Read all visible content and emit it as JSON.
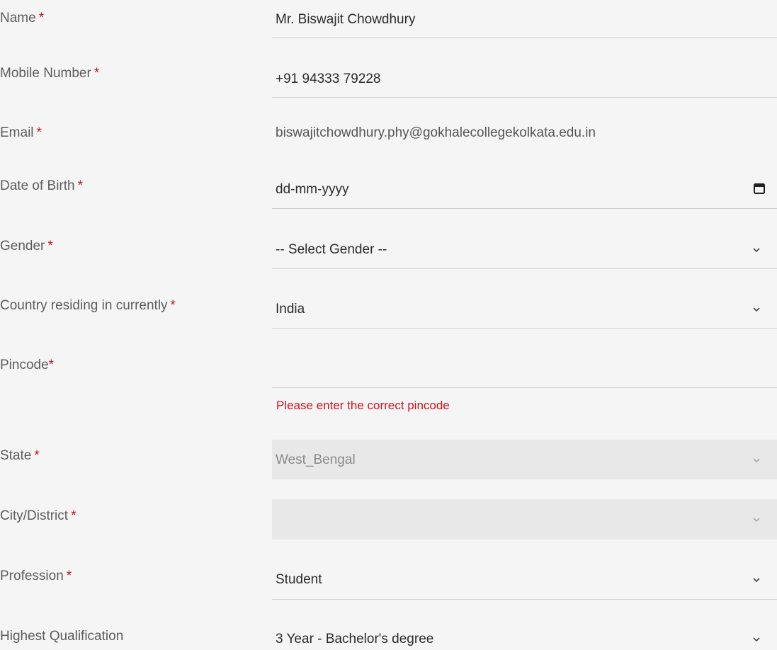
{
  "form": {
    "name": {
      "label": "Name",
      "required": "*",
      "value": "Mr. Biswajit Chowdhury"
    },
    "mobile": {
      "label": "Mobile Number",
      "required": "*",
      "value": "+91 94333 79228"
    },
    "email": {
      "label": "Email",
      "required": "*",
      "value": "biswajitchowdhury.phy@gokhalecollegekolkata.edu.in"
    },
    "dob": {
      "label": "Date of Birth",
      "required": "*",
      "value": "dd-mm-yyyy",
      "icon": "calendar-icon"
    },
    "gender": {
      "label": "Gender",
      "required": "*",
      "value": "-- Select Gender --",
      "icon": "chevron-down-icon"
    },
    "country": {
      "label": "Country residing in currently",
      "required": "*",
      "value": "India",
      "icon": "chevron-down-icon"
    },
    "pincode": {
      "label": "Pincode",
      "required": "*",
      "value": "",
      "error": "Please enter the correct pincode"
    },
    "state": {
      "label": "State",
      "required": "*",
      "value": "West_Bengal",
      "disabled": true,
      "icon": "chevron-down-icon"
    },
    "city": {
      "label": "City/District",
      "required": "*",
      "value": "",
      "disabled": true,
      "icon": "chevron-down-icon"
    },
    "profession": {
      "label": "Profession",
      "required": "*",
      "value": "Student",
      "icon": "chevron-down-icon"
    },
    "qualification": {
      "label": "Highest Qualification",
      "value": "3 Year - Bachelor's degree",
      "icon": "chevron-down-icon"
    }
  },
  "colors": {
    "background": "#f5f5f5",
    "required_mark": "#c2141e",
    "error_text": "#d0141e",
    "disabled_field": "#e8e8e8"
  }
}
